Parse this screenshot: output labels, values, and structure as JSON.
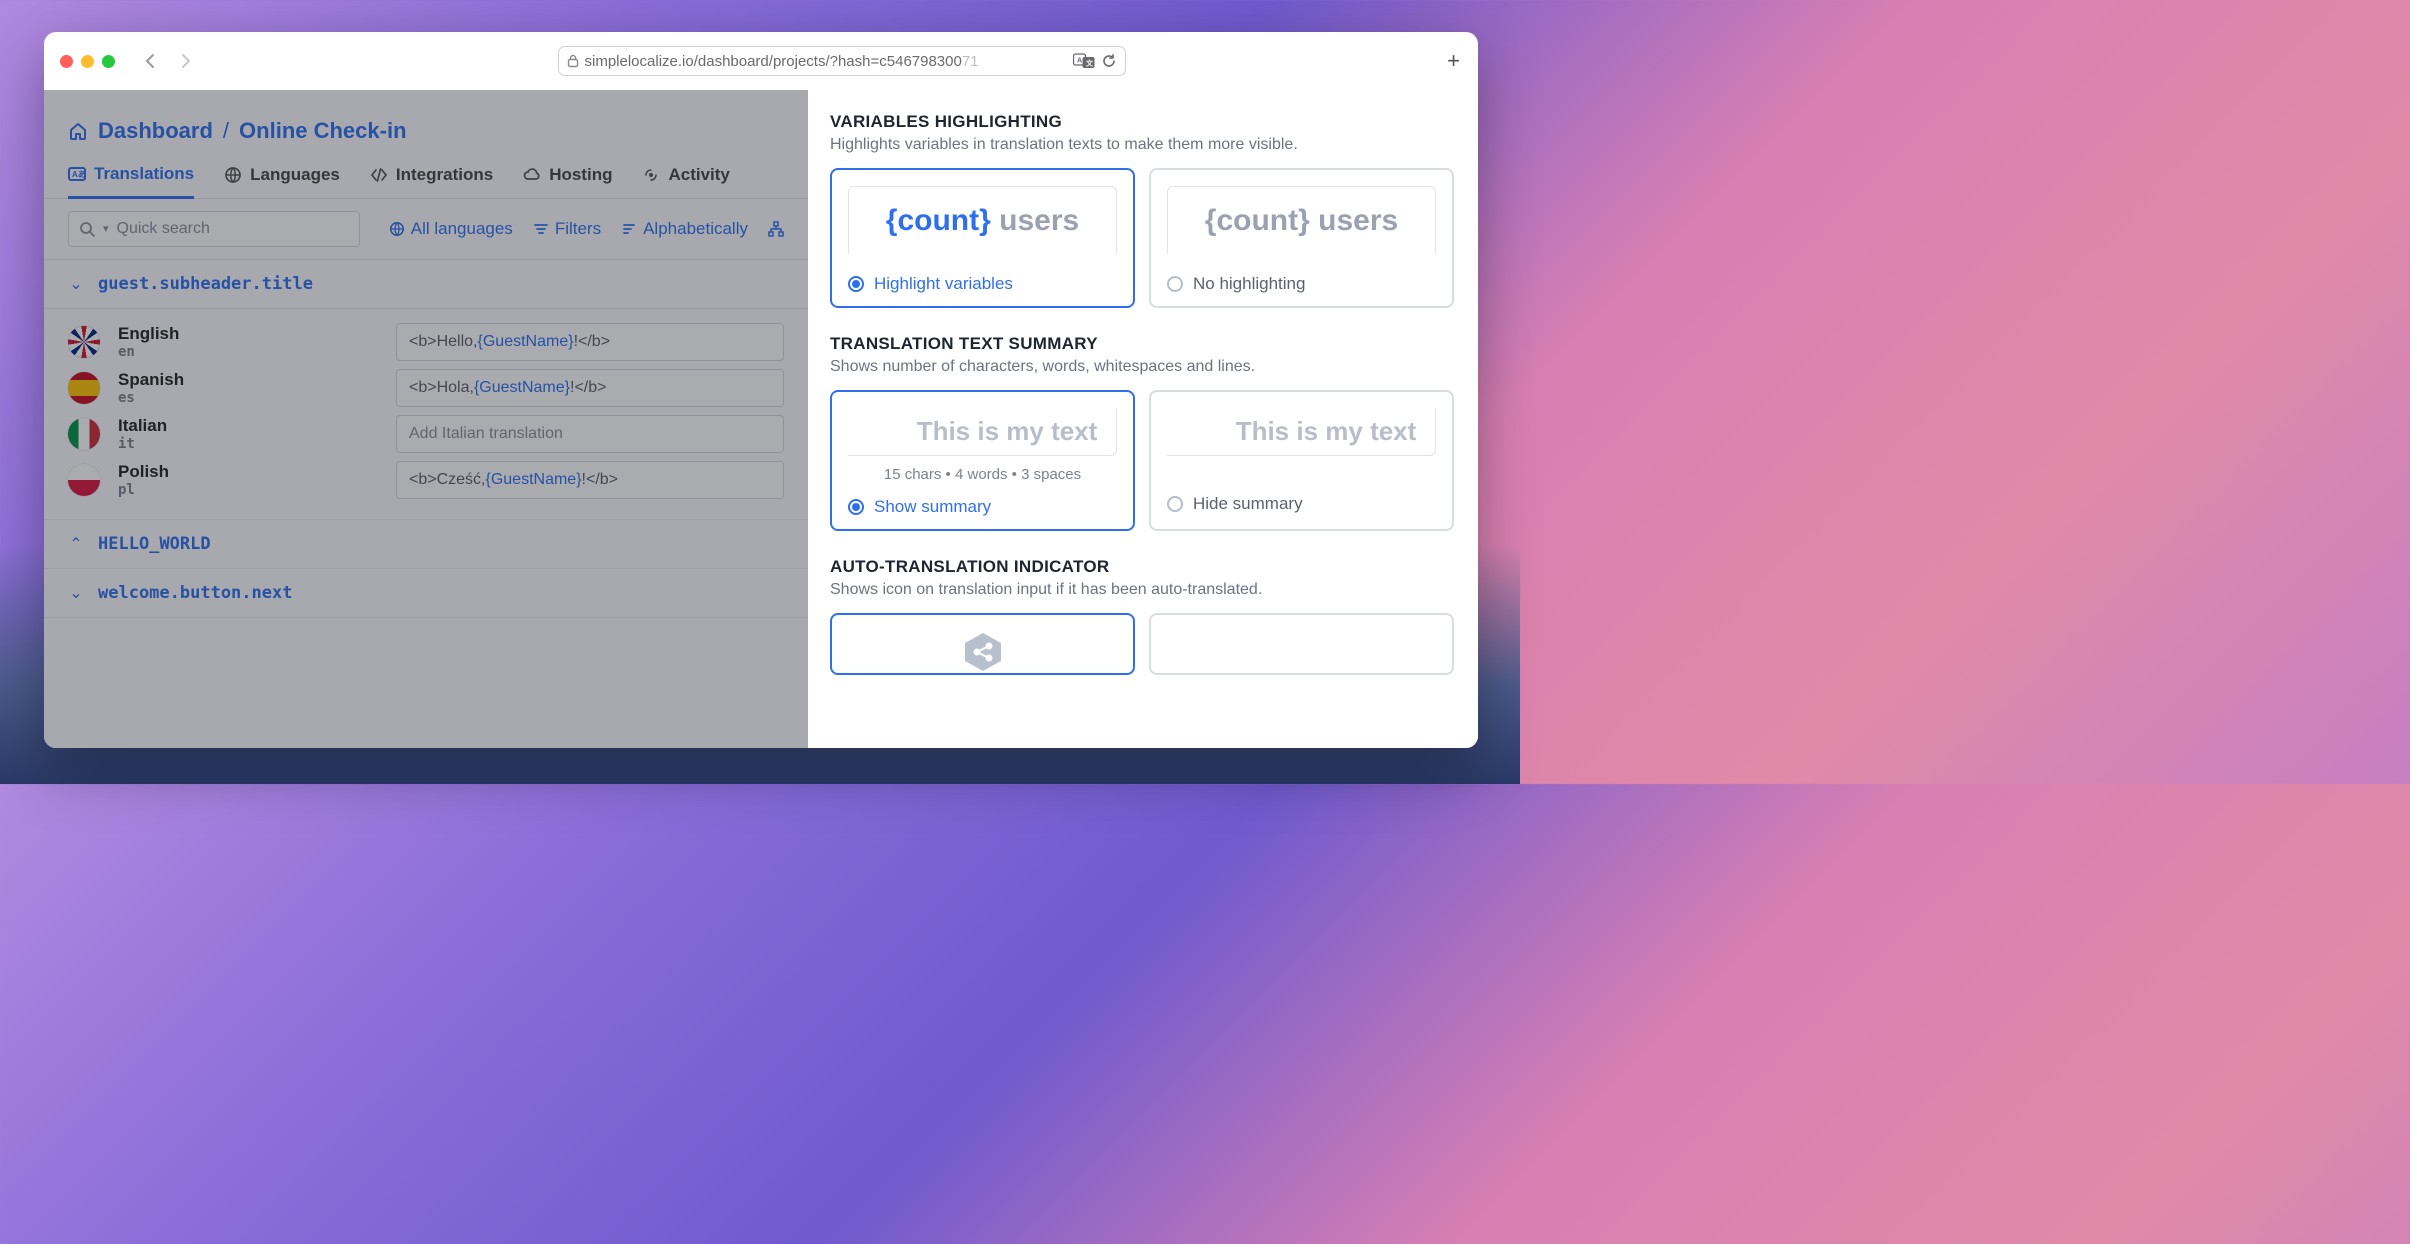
{
  "browser": {
    "url": "simplelocalize.io/dashboard/projects/?hash=c546798300",
    "url_tail": "71"
  },
  "breadcrumb": {
    "dashboard": "Dashboard",
    "separator": "/",
    "project": "Online Check-in"
  },
  "tabs": {
    "translations": "Translations",
    "languages": "Languages",
    "integrations": "Integrations",
    "hosting": "Hosting",
    "activity": "Activity"
  },
  "toolbar": {
    "search_placeholder": "Quick search",
    "all_languages": "All languages",
    "filters": "Filters",
    "sort": "Alphabetically"
  },
  "keys": [
    {
      "name": "guest.subheader.title",
      "expanded": true,
      "rows": [
        {
          "lang": "English",
          "code": "en",
          "flag": "flag-en",
          "prefix": "<b>Hello, ",
          "var": "{GuestName}",
          "suffix": "!</b>",
          "placeholder": ""
        },
        {
          "lang": "Spanish",
          "code": "es",
          "flag": "flag-es",
          "prefix": "<b>Hola, ",
          "var": "{GuestName}",
          "suffix": "!</b>",
          "placeholder": ""
        },
        {
          "lang": "Italian",
          "code": "it",
          "flag": "flag-it",
          "prefix": "",
          "var": "",
          "suffix": "",
          "placeholder": "Add Italian translation"
        },
        {
          "lang": "Polish",
          "code": "pl",
          "flag": "flag-pl",
          "prefix": "<b>Cześć, ",
          "var": "{GuestName}",
          "suffix": "!</b>",
          "placeholder": ""
        }
      ]
    },
    {
      "name": "HELLO_WORLD",
      "expanded": false
    },
    {
      "name": "welcome.button.next",
      "expanded": false
    }
  ],
  "panel": {
    "sections": [
      {
        "title": "VARIABLES HIGHLIGHTING",
        "desc": "Highlights variables in translation texts to make them more visible.",
        "preview_var": "{count}",
        "preview_text": " users",
        "opt_a": "Highlight variables",
        "opt_b": "No highlighting"
      },
      {
        "title": "TRANSLATION TEXT SUMMARY",
        "desc": "Shows number of characters, words, whitespaces and lines.",
        "preview_text": "This is my text",
        "subline": "15 chars  •  4 words  •  3 spaces",
        "opt_a": "Show summary",
        "opt_b": "Hide summary"
      },
      {
        "title": "AUTO-TRANSLATION INDICATOR",
        "desc": "Shows icon on translation input if it has been auto-translated."
      }
    ]
  }
}
